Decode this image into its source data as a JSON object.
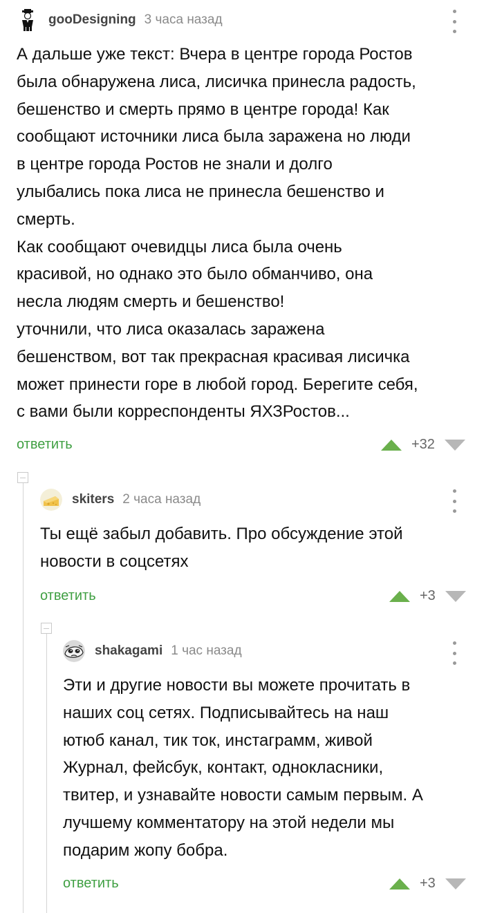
{
  "comments": [
    {
      "author": "gooDesigning",
      "time": "3 часа назад",
      "text": "А дальше уже текст: Вчера в центре города Ростов\nбыла обнаружена лиса, лисичка принесла радость,\nбешенство и смерть прямо в центре города! Как\nсообщают источники лиса была заражена но люди\nв центре города Ростов не знали и долго\nулыбались пока лиса не принесла бешенство и\nсмерть.\nКак сообщают очевидцы лиса была очень\nкрасивой, но однако это было обманчиво, она\nнесла людям смерть и бешенство!\nуточнили, что лиса оказалась заражена\nбешенством, вот так прекрасная красивая лисичка\nможет принести горе в любой город. Берегите себя,\nс вами были корреспонденты ЯХЗРостов...",
      "reply_label": "ответить",
      "rating": "+32"
    },
    {
      "author": "skiters",
      "time": "2 часа назад",
      "text": "Ты ещё забыл добавить. Про обсуждение этой\nновости в соцсетях",
      "reply_label": "ответить",
      "rating": "+3"
    },
    {
      "author": "shakagami",
      "time": "1 час назад",
      "text": "Эти и другие новости вы можете прочитать в\nнаших соц сетях. Подписывайтесь на наш\nютюб канал, тик ток, инстаграмм, живой\nЖурнал, фейсбук, контакт, однокласники,\nтвитер, и узнавайте новости самым первым. А\nлучшему комментатору на этой недели мы\nподарим жопу бобра.",
      "reply_label": "ответить",
      "rating": "+3"
    }
  ],
  "colors": {
    "reply_link": "#3f9f42",
    "upvote": "#6ab04c",
    "downvote": "#b7b7b7",
    "meta": "#8a8a8a"
  },
  "icons": {
    "avatar_1": "man-in-black-suit-avatar",
    "avatar_2": "yellow-cheese-avatar",
    "avatar_3": "sketch-face-avatar",
    "more": "vertical-dots-icon",
    "collapse": "collapse-minus-icon"
  }
}
